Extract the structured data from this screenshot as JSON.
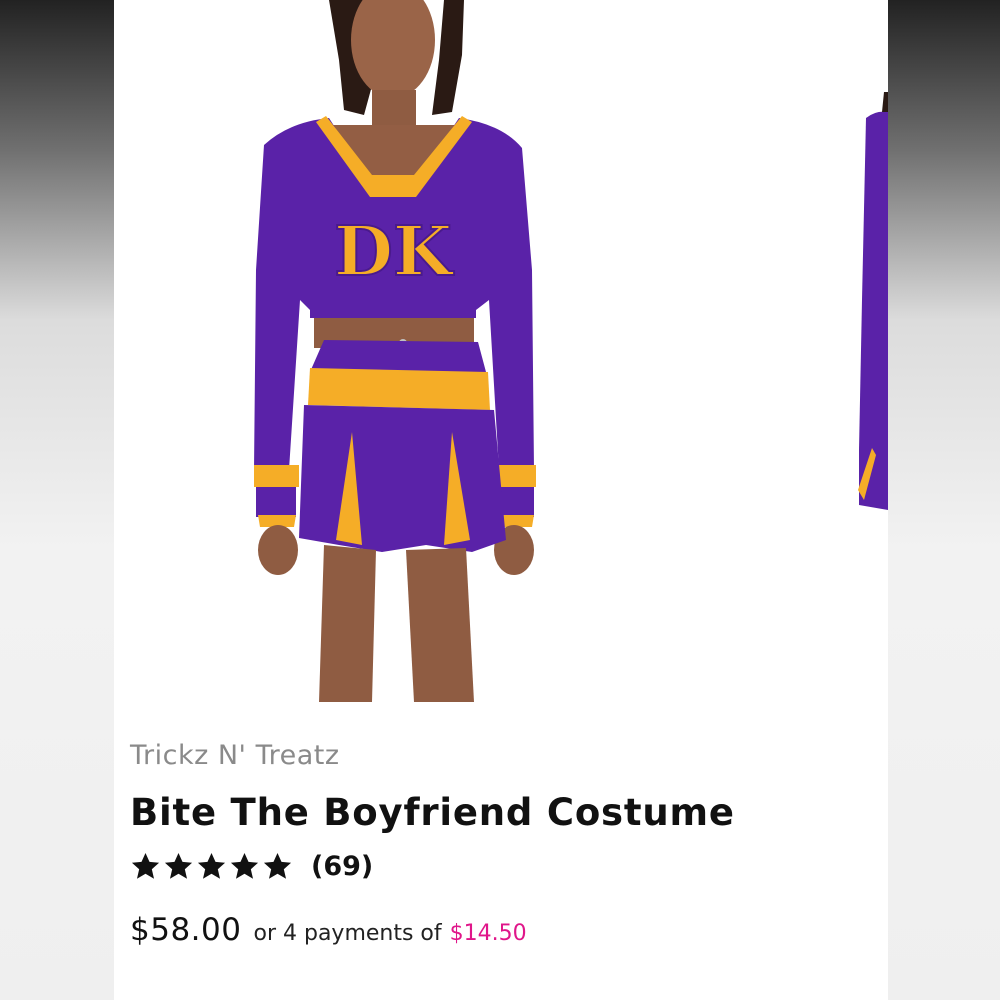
{
  "product": {
    "brand": "Trickz N' Treatz",
    "title": "Bite The Boyfriend Costume",
    "rating": 5,
    "review_count": "(69)",
    "price": "$58.00",
    "installment_text": "or 4 payments of",
    "installment_amount": "$14.50"
  },
  "image": {
    "logo_text": "DK",
    "primary_color": "#5a22a8",
    "accent_color": "#f5ad27"
  },
  "colors": {
    "star": "#111111",
    "installment_accent": "#e0168a"
  }
}
